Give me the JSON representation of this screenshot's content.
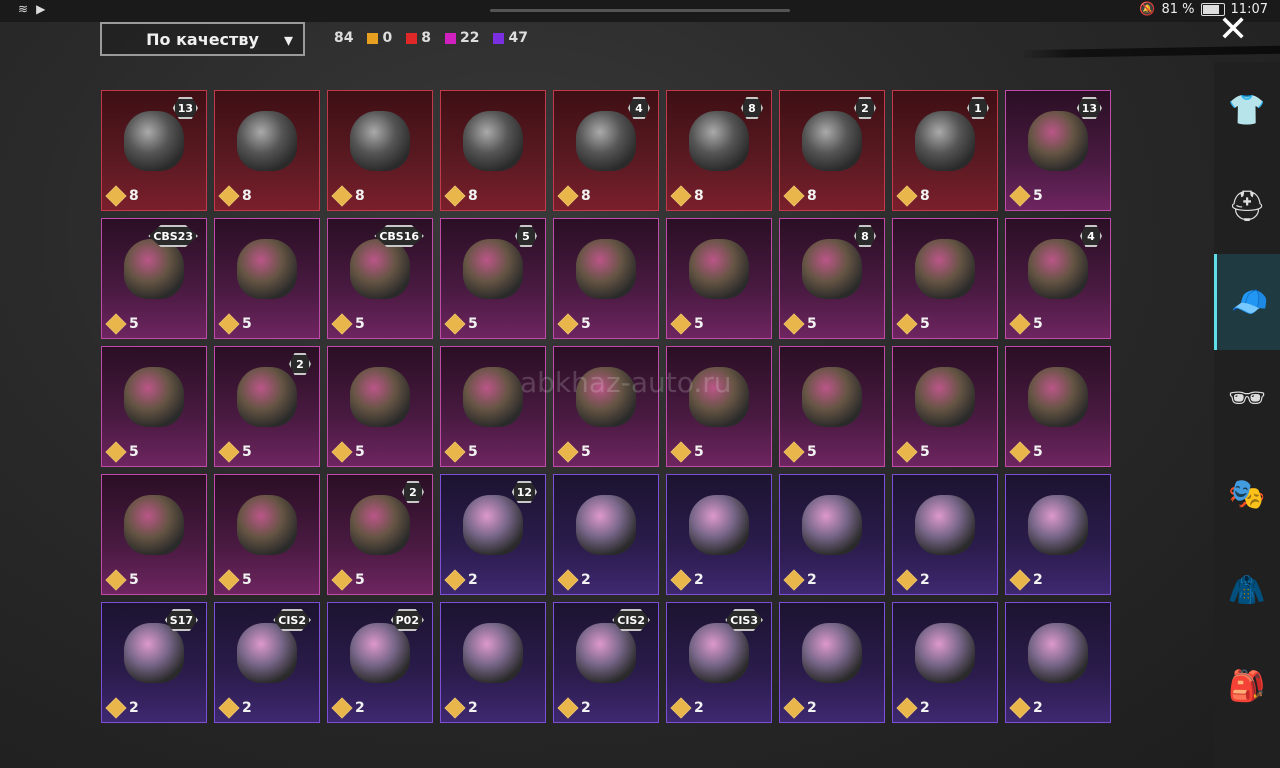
{
  "status_bar": {
    "left_icons": [
      "wifi-icon",
      "youtube-icon"
    ],
    "battery": "81 %",
    "battery_level": 0.81,
    "time": "11:07"
  },
  "sort": {
    "label": "По качеству",
    "chevron": "▾"
  },
  "totals": {
    "all": "84",
    "categories": [
      {
        "color": "#e8a020",
        "count": "0"
      },
      {
        "color": "#e02828",
        "count": "8"
      },
      {
        "color": "#d020c0",
        "count": "22"
      },
      {
        "color": "#7a30e0",
        "count": "47"
      }
    ]
  },
  "close_label": "✕",
  "watermark": "abkhaz-auto.ru",
  "items": [
    {
      "rarity": "red",
      "badge": "13",
      "count": "8"
    },
    {
      "rarity": "red",
      "badge": "",
      "count": "8"
    },
    {
      "rarity": "red",
      "badge": "",
      "count": "8"
    },
    {
      "rarity": "red",
      "badge": "",
      "count": "8"
    },
    {
      "rarity": "red",
      "badge": "4",
      "count": "8"
    },
    {
      "rarity": "red",
      "badge": "8",
      "count": "8"
    },
    {
      "rarity": "red",
      "badge": "2",
      "count": "8"
    },
    {
      "rarity": "red",
      "badge": "1",
      "count": "8"
    },
    {
      "rarity": "pink",
      "badge": "13",
      "count": "5"
    },
    {
      "rarity": "pink",
      "badge": "CBS23",
      "count": "5"
    },
    {
      "rarity": "pink",
      "badge": "",
      "count": "5"
    },
    {
      "rarity": "pink",
      "badge": "CBS16",
      "count": "5"
    },
    {
      "rarity": "pink",
      "badge": "5",
      "count": "5"
    },
    {
      "rarity": "pink",
      "badge": "",
      "count": "5"
    },
    {
      "rarity": "pink",
      "badge": "",
      "count": "5"
    },
    {
      "rarity": "pink",
      "badge": "8",
      "count": "5"
    },
    {
      "rarity": "pink",
      "badge": "",
      "count": "5"
    },
    {
      "rarity": "pink",
      "badge": "4",
      "count": "5"
    },
    {
      "rarity": "pink",
      "badge": "",
      "count": "5"
    },
    {
      "rarity": "pink",
      "badge": "2",
      "count": "5"
    },
    {
      "rarity": "pink",
      "badge": "",
      "count": "5"
    },
    {
      "rarity": "pink",
      "badge": "",
      "count": "5"
    },
    {
      "rarity": "pink",
      "badge": "",
      "count": "5"
    },
    {
      "rarity": "pink",
      "badge": "",
      "count": "5"
    },
    {
      "rarity": "pink",
      "badge": "",
      "count": "5"
    },
    {
      "rarity": "pink",
      "badge": "",
      "count": "5"
    },
    {
      "rarity": "pink",
      "badge": "",
      "count": "5"
    },
    {
      "rarity": "pink",
      "badge": "",
      "count": "5"
    },
    {
      "rarity": "pink",
      "badge": "",
      "count": "5"
    },
    {
      "rarity": "pink",
      "badge": "2",
      "count": "5"
    },
    {
      "rarity": "purple",
      "badge": "12",
      "count": "2"
    },
    {
      "rarity": "purple",
      "badge": "",
      "count": "2"
    },
    {
      "rarity": "purple",
      "badge": "",
      "count": "2"
    },
    {
      "rarity": "purple",
      "badge": "",
      "count": "2"
    },
    {
      "rarity": "purple",
      "badge": "",
      "count": "2"
    },
    {
      "rarity": "purple",
      "badge": "",
      "count": "2"
    },
    {
      "rarity": "purple",
      "badge": "S17",
      "count": "2"
    },
    {
      "rarity": "purple",
      "badge": "CIS2",
      "count": "2"
    },
    {
      "rarity": "purple",
      "badge": "P02",
      "count": "2"
    },
    {
      "rarity": "purple",
      "badge": "",
      "count": "2"
    },
    {
      "rarity": "purple",
      "badge": "CIS2",
      "count": "2"
    },
    {
      "rarity": "purple",
      "badge": "CIS3",
      "count": "2"
    },
    {
      "rarity": "purple",
      "badge": "",
      "count": "2"
    },
    {
      "rarity": "purple",
      "badge": "",
      "count": "2"
    },
    {
      "rarity": "purple",
      "badge": "",
      "count": "2"
    }
  ],
  "side_tabs": [
    {
      "name": "outfit-icon",
      "glyph": "👕",
      "active": false
    },
    {
      "name": "helmet-icon",
      "glyph": "⛑",
      "active": false
    },
    {
      "name": "cap-icon",
      "glyph": "🧢",
      "active": true
    },
    {
      "name": "glasses-icon",
      "glyph": "🕶",
      "active": false
    },
    {
      "name": "mask-icon",
      "glyph": "🎭",
      "active": false
    },
    {
      "name": "jacket-icon",
      "glyph": "🧥",
      "active": false
    },
    {
      "name": "backpack-icon",
      "glyph": "🎒",
      "active": false
    }
  ]
}
